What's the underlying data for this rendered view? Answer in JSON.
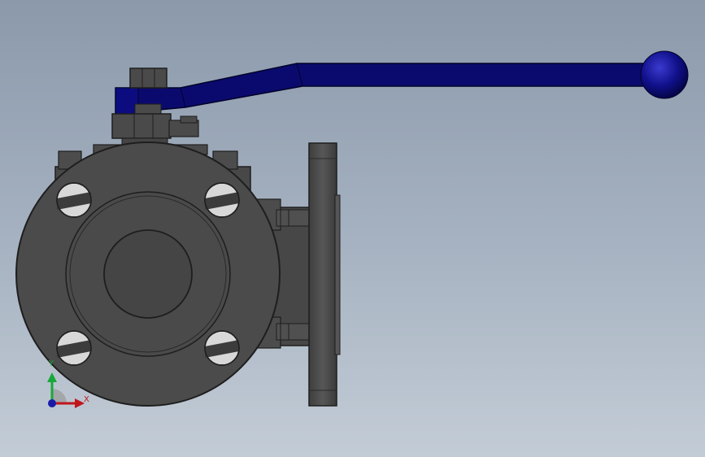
{
  "viewport": {
    "background_top": "#8b99ab",
    "background_bottom": "#c3ccd6",
    "model": {
      "body_color": "#4a4a4a",
      "edge_color": "#1e1e1e",
      "handle_color": "#0a0a6e",
      "knob_color": "#0f0f8a"
    }
  },
  "triad": {
    "x_label": "X",
    "y_label": "Y",
    "x_color": "#c0151c",
    "y_color": "#18a83a",
    "z_color": "#1a1aa8"
  }
}
